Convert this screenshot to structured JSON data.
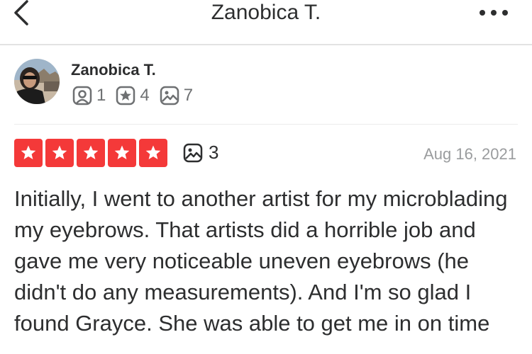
{
  "header": {
    "title": "Zanobica T.",
    "back_icon": "chevron-left-icon",
    "more_icon": "more-horizontal-icon"
  },
  "user": {
    "name": "Zanobica T.",
    "stats": [
      {
        "icon": "friends-icon",
        "value": "1"
      },
      {
        "icon": "star-review-icon",
        "value": "4"
      },
      {
        "icon": "photo-icon",
        "value": "7"
      }
    ]
  },
  "review": {
    "rating": 5,
    "photo_count": "3",
    "date": "Aug 16, 2021",
    "text": "Initially, I went to another artist for my microblading my eyebrows. That artists did a horrible job and gave me very noticeable uneven eyebrows (he didn't do any measurements). And I'm so glad I found Grayce. She was able to get me in on time"
  },
  "colors": {
    "star_red": "#f43939",
    "text": "#2d2e2f",
    "muted": "#9a9c9e"
  }
}
